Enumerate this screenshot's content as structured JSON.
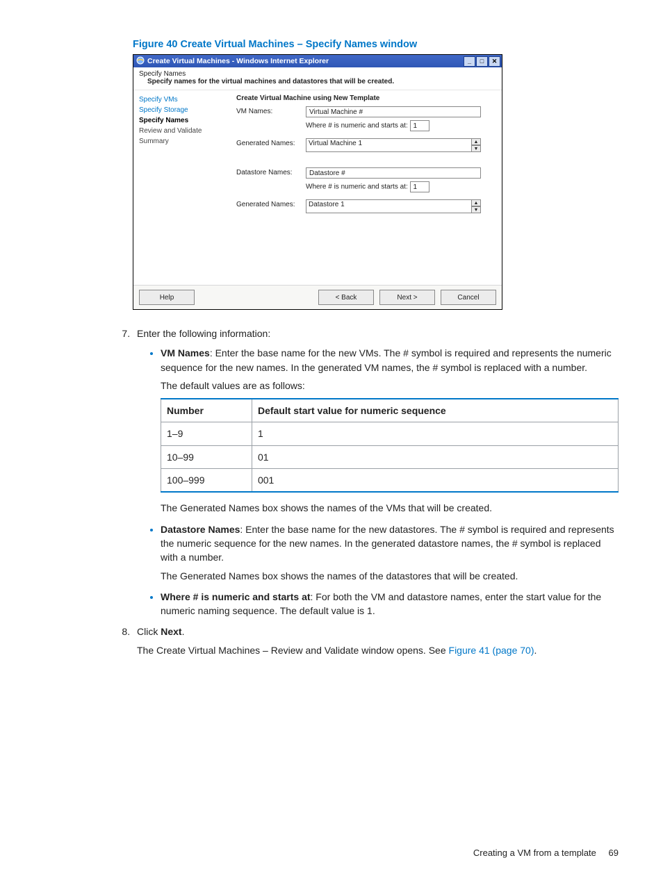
{
  "figure_title": "Figure 40 Create Virtual Machines – Specify Names window",
  "window": {
    "title": "Create Virtual Machines - Windows Internet Explorer",
    "header_line1": "Specify Names",
    "header_line2": "Specify names for the virtual machines and datastores that will be created.",
    "nav": {
      "specify_vms": "Specify VMs",
      "specify_storage": "Specify Storage",
      "specify_names": "Specify Names",
      "review": "Review and Validate",
      "summary": "Summary"
    },
    "main": {
      "section_title": "Create Virtual Machine using New Template",
      "vm_names_label": "VM Names:",
      "vm_names_value": "Virtual Machine #",
      "where_numeric_label": "Where # is numeric and starts at:",
      "vm_start_value": "1",
      "generated_label": "Generated Names:",
      "vm_generated_value": "Virtual Machine 1",
      "ds_names_label": "Datastore Names:",
      "ds_names_value": "Datastore #",
      "ds_start_value": "1",
      "ds_generated_value": "Datastore 1"
    },
    "buttons": {
      "help": "Help",
      "back": "< Back",
      "next": "Next >",
      "cancel": "Cancel"
    }
  },
  "step7_intro": "Enter the following information:",
  "bullet_vm_names_bold": "VM Names",
  "bullet_vm_names_text": ": Enter the base name for the new VMs. The # symbol is required and represents the numeric sequence for the new names. In the generated VM names, the # symbol is replaced with a number.",
  "default_values_line": "The default values are as follows:",
  "table": {
    "h1": "Number",
    "h2": "Default start value for numeric sequence",
    "rows": [
      {
        "c1": "1–9",
        "c2": "1"
      },
      {
        "c1": "10–99",
        "c2": "01"
      },
      {
        "c1": "100–999",
        "c2": "001"
      }
    ]
  },
  "generated_names_vm_line": "The Generated Names box shows the names of the VMs that will be created.",
  "bullet_ds_bold": "Datastore Names",
  "bullet_ds_text": ": Enter the base name for the new datastores. The # symbol is required and represents the numeric sequence for the new names. In the generated datastore names, the # symbol is replaced with a number.",
  "generated_names_ds_line": "The Generated Names box shows the names of the datastores that will be created.",
  "bullet_where_bold": "Where # is numeric and starts at",
  "bullet_where_text": ": For both the VM and datastore names, enter the start value for the numeric naming sequence. The default value is 1.",
  "step8_prefix": "Click ",
  "step8_bold": "Next",
  "step8_suffix": ".",
  "step8_para": "The Create Virtual Machines – Review and Validate window opens. See ",
  "step8_link": "Figure 41 (page 70)",
  "step8_period": ".",
  "footer_text": "Creating a VM from a template",
  "page_number": "69"
}
